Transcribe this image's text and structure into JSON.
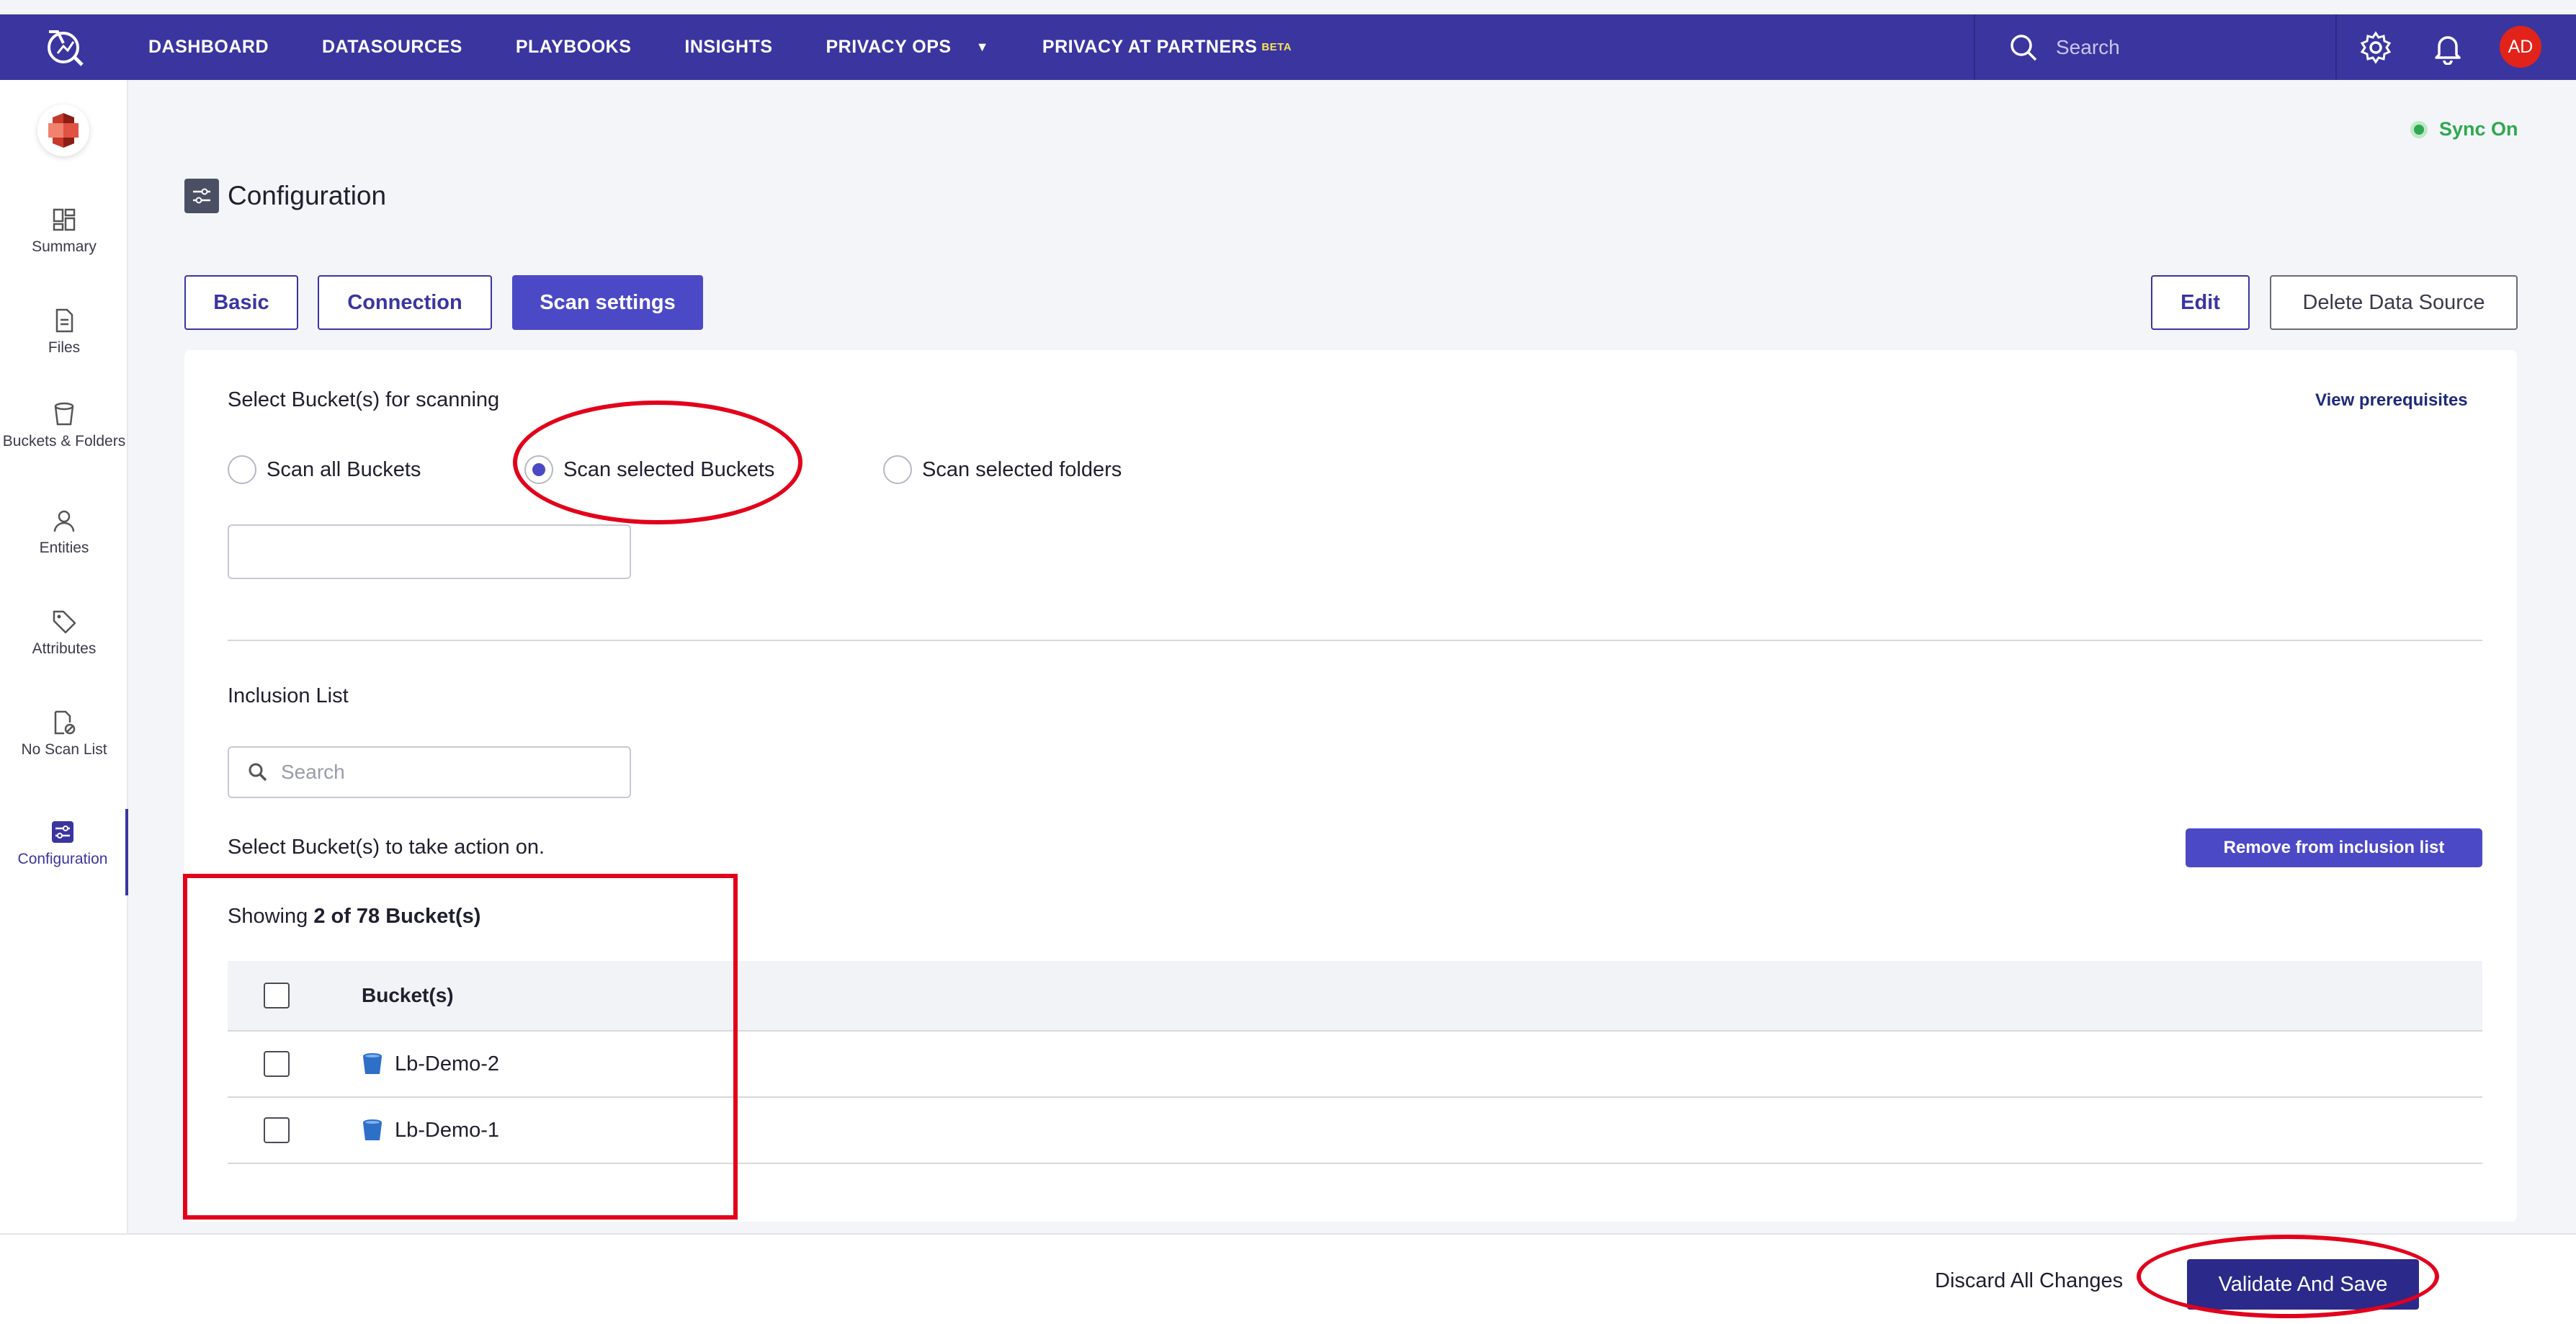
{
  "nav": {
    "items": [
      "DASHBOARD",
      "DATASOURCES",
      "PLAYBOOKS",
      "INSIGHTS",
      "PRIVACY OPS",
      "PRIVACY AT PARTNERS"
    ],
    "beta_badge": "BETA",
    "search_placeholder": "Search",
    "avatar_initials": "AD"
  },
  "sidebar": {
    "items": [
      {
        "label": "Summary",
        "icon": "summary-icon"
      },
      {
        "label": "Files",
        "icon": "file-icon"
      },
      {
        "label": "Buckets & Folders",
        "icon": "bucket-icon"
      },
      {
        "label": "Entities",
        "icon": "user-icon"
      },
      {
        "label": "Attributes",
        "icon": "tag-icon"
      },
      {
        "label": "No Scan List",
        "icon": "no-scan-icon"
      },
      {
        "label": "Configuration",
        "icon": "configuration-icon"
      }
    ],
    "active": "Configuration"
  },
  "status": {
    "sync": "Sync On"
  },
  "page": {
    "title": "Configuration"
  },
  "tabs": {
    "basic": "Basic",
    "connection": "Connection",
    "scan_settings": "Scan settings",
    "active": "Scan settings"
  },
  "actions": {
    "edit": "Edit",
    "delete": "Delete Data Source"
  },
  "scan": {
    "section_label": "Select Bucket(s) for scanning",
    "prereq_link": "View prerequisites",
    "options": [
      "Scan all Buckets",
      "Scan selected Buckets",
      "Scan selected folders"
    ],
    "selected": "Scan selected Buckets",
    "input_value": ""
  },
  "inclusion": {
    "title": "Inclusion List",
    "search_placeholder": "Search",
    "select_hint": "Select Bucket(s) to take action on.",
    "remove_button": "Remove from inclusion list",
    "showing_prefix": "Showing ",
    "showing_count": "2 of 78 Bucket(s)",
    "column_header": "Bucket(s)",
    "rows": [
      "Lb-Demo-2",
      "Lb-Demo-1"
    ]
  },
  "footer": {
    "discard": "Discard All Changes",
    "save": "Validate And Save"
  },
  "colors": {
    "brand": "#3b35a0",
    "primary_button": "#4c49c6",
    "sync_green": "#2fa84f",
    "annotation_red": "#e3001b"
  }
}
